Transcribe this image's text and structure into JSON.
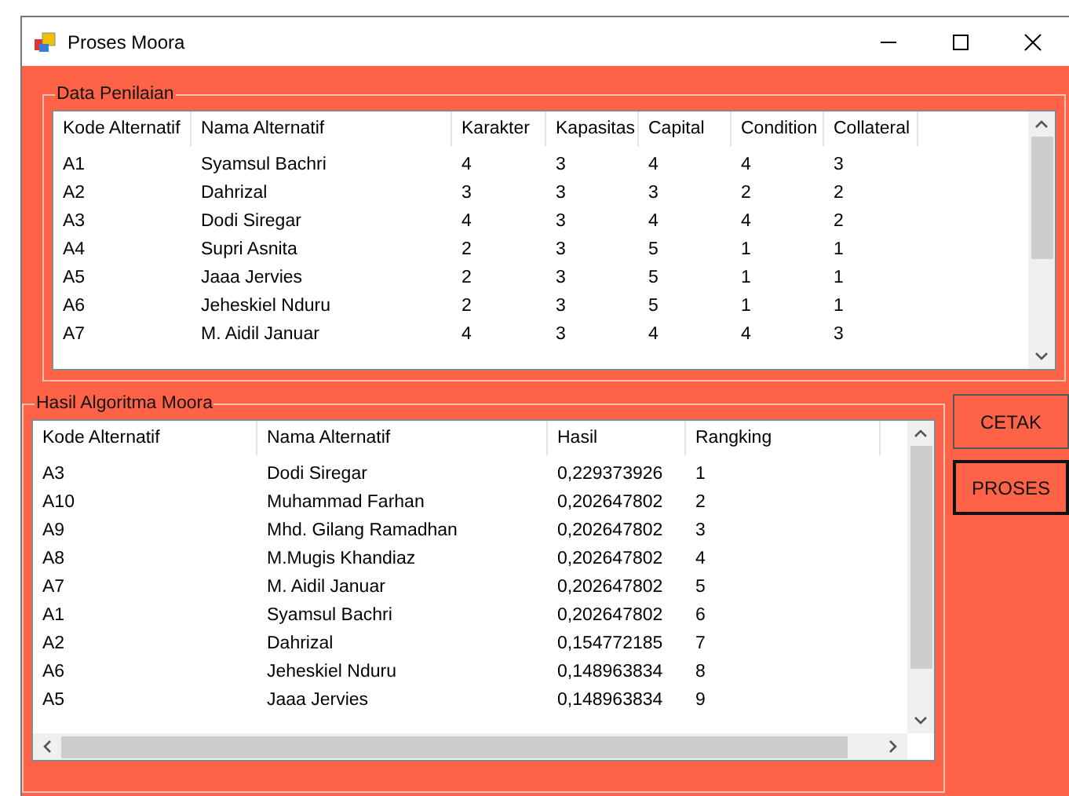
{
  "window": {
    "title": "Proses Moora"
  },
  "penilaian": {
    "title": "Data Penilaian",
    "columns": [
      "Kode Alternatif",
      "Nama Alternatif",
      "Karakter",
      "Kapasitas",
      "Capital",
      "Condition",
      "Collateral"
    ],
    "rows": [
      [
        "A1",
        "Syamsul Bachri",
        "4",
        "3",
        "4",
        "4",
        "3"
      ],
      [
        "A2",
        "Dahrizal",
        "3",
        "3",
        "3",
        "2",
        "2"
      ],
      [
        "A3",
        "Dodi Siregar",
        "4",
        "3",
        "4",
        "4",
        "2"
      ],
      [
        "A4",
        "Supri Asnita",
        "2",
        "3",
        "5",
        "1",
        "1"
      ],
      [
        "A5",
        "Jaaa Jervies",
        "2",
        "3",
        "5",
        "1",
        "1"
      ],
      [
        "A6",
        "Jeheskiel Nduru",
        "2",
        "3",
        "5",
        "1",
        "1"
      ],
      [
        "A7",
        "M. Aidil Januar",
        "4",
        "3",
        "4",
        "4",
        "3"
      ]
    ]
  },
  "hasil": {
    "title": "Hasil Algoritma Moora",
    "columns": [
      "Kode Alternatif",
      "Nama Alternatif",
      "Hasil",
      "Rangking"
    ],
    "rows": [
      [
        "A3",
        "Dodi Siregar",
        "0,229373926",
        "1"
      ],
      [
        "A10",
        "Muhammad Farhan",
        "0,202647802",
        "2"
      ],
      [
        "A9",
        "Mhd. Gilang Ramadhan",
        "0,202647802",
        "3"
      ],
      [
        "A8",
        "M.Mugis Khandiaz",
        "0,202647802",
        "4"
      ],
      [
        "A7",
        "M. Aidil Januar",
        "0,202647802",
        "5"
      ],
      [
        "A1",
        "Syamsul Bachri",
        "0,202647802",
        "6"
      ],
      [
        "A2",
        "Dahrizal",
        "0,154772185",
        "7"
      ],
      [
        "A6",
        "Jeheskiel Nduru",
        "0,148963834",
        "8"
      ],
      [
        "A5",
        "Jaaa Jervies",
        "0,148963834",
        "9"
      ]
    ]
  },
  "buttons": [
    {
      "label": "CETAK",
      "default": false
    },
    {
      "label": "PROSES",
      "default": true
    }
  ]
}
